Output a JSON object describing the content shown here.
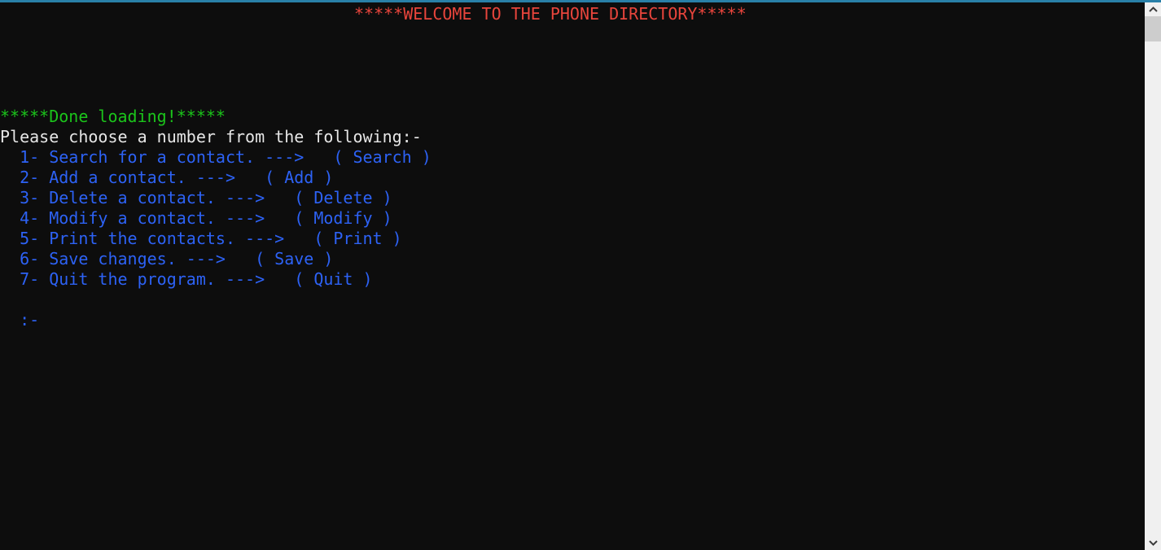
{
  "window": {
    "accent_strip_color": "#2980a8",
    "background_color": "#0d0d0d"
  },
  "console": {
    "title": "*****WELCOME TO THE PHONE DIRECTORY*****",
    "title_color": "#e8453c",
    "status": "*****Done loading!*****",
    "status_color": "#1bc41b",
    "prompt_text": "Please choose a number from the following:-",
    "prompt_text_color": "#e6e6e6",
    "menu_color": "#2d62f5",
    "menu": [
      {
        "line": "  1- Search for a contact. --->   ( Search )"
      },
      {
        "line": "  2- Add a contact. --->   ( Add )"
      },
      {
        "line": "  3- Delete a contact. --->   ( Delete )"
      },
      {
        "line": "  4- Modify a contact. --->   ( Modify )"
      },
      {
        "line": "  5- Print the contacts. --->   ( Print )"
      },
      {
        "line": "  6- Save changes. --->   ( Save )"
      },
      {
        "line": "  7- Quit the program. --->   ( Quit )"
      }
    ],
    "input_prompt": "  :-",
    "input_value": ""
  },
  "scrollbar": {
    "up_icon": "chevron-up-icon",
    "down_icon": "chevron-down-icon",
    "track_color": "#f0f0f0",
    "thumb_color": "#cdcdcd"
  }
}
